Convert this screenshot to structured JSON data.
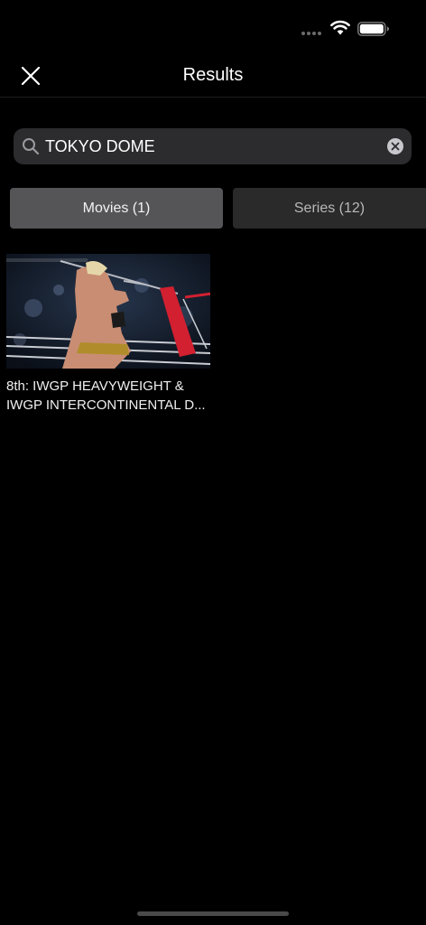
{
  "header": {
    "title": "Results",
    "close_icon": "close-icon"
  },
  "search": {
    "value": "TOKYO DOME",
    "icon": "search-icon",
    "clear_icon": "clear-icon"
  },
  "tabs": [
    {
      "label": "Movies (1)",
      "selected": true
    },
    {
      "label": "Series (12)",
      "selected": false
    }
  ],
  "results": [
    {
      "title_line1": "8th: IWGP HEAVYWEIGHT &",
      "title_line2": "IWGP INTERCONTINENTAL D..."
    }
  ],
  "colors": {
    "background": "#000000",
    "search_bg": "#2c2c2e",
    "tab_selected": "#555557",
    "tab_unselected": "#2a2a2a"
  }
}
